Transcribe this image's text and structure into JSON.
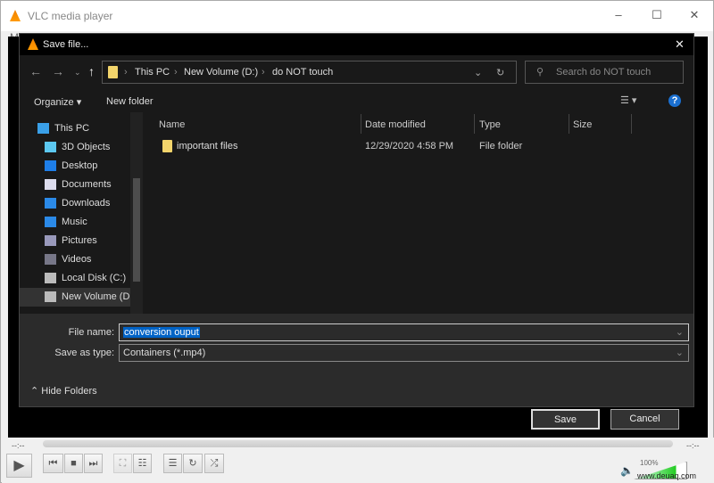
{
  "vlc": {
    "title": "VLC media player",
    "menu_hint": "M",
    "time_elapsed": "--:--",
    "time_total": "--:--",
    "volume": "100%",
    "volume_level": 100,
    "watermark": "www.deuaq.com"
  },
  "dialog": {
    "title": "Save file...",
    "breadcrumb": [
      "This PC",
      "New Volume (D:)",
      "do NOT touch"
    ],
    "search_placeholder": "Search do NOT touch",
    "toolbar": {
      "organize": "Organize",
      "new_folder": "New folder"
    },
    "nav_items": [
      {
        "label": "This PC",
        "icon": "computer-icon"
      },
      {
        "label": "3D Objects",
        "icon": "cube-icon"
      },
      {
        "label": "Desktop",
        "icon": "desktop-icon"
      },
      {
        "label": "Documents",
        "icon": "document-icon"
      },
      {
        "label": "Downloads",
        "icon": "download-icon"
      },
      {
        "label": "Music",
        "icon": "music-icon"
      },
      {
        "label": "Pictures",
        "icon": "pictures-icon"
      },
      {
        "label": "Videos",
        "icon": "videos-icon"
      },
      {
        "label": "Local Disk (C:)",
        "icon": "drive-icon"
      },
      {
        "label": "New Volume (D:)",
        "icon": "drive-icon"
      }
    ],
    "columns": [
      "Name",
      "Date modified",
      "Type",
      "Size"
    ],
    "files": [
      {
        "name": "important files",
        "date": "12/29/2020 4:58 PM",
        "type": "File folder",
        "size": ""
      }
    ],
    "file_name_label": "File name:",
    "file_name_value": "conversion ouput",
    "save_type_label": "Save as type:",
    "save_type_value": "Containers (*.mp4)",
    "hide_folders": "Hide Folders",
    "save": "Save",
    "cancel": "Cancel"
  }
}
